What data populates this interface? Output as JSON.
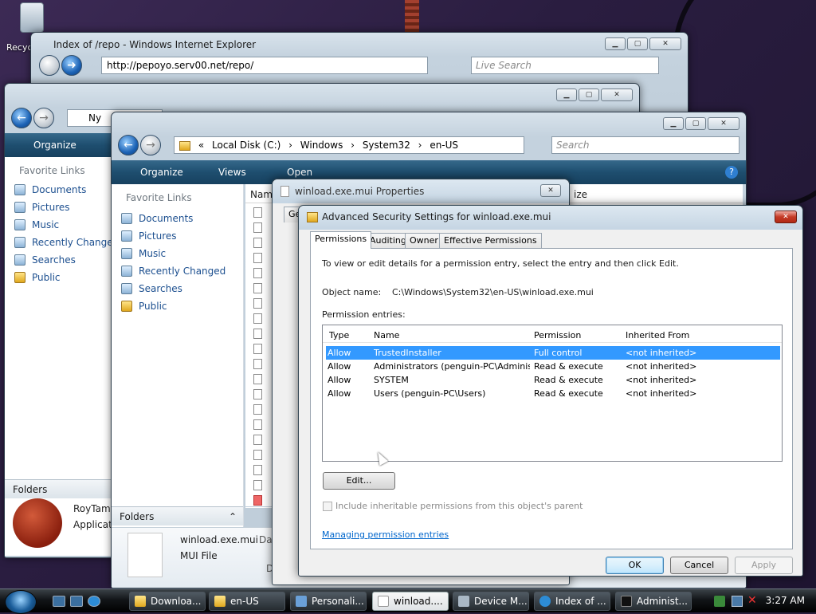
{
  "desktop": {
    "recycle_bin_label": "Recyc"
  },
  "ie": {
    "title": "Index of /repo - Windows Internet Explorer",
    "url": "http://pepoyo.serv00.net/repo/",
    "search_placeholder": "Live Search"
  },
  "explorer1": {
    "address": "Ny",
    "organize": "Organize",
    "favorite_links_header": "Favorite Links",
    "links": [
      "Documents",
      "Pictures",
      "Music",
      "Recently Changed",
      "Searches",
      "Public"
    ],
    "folders": "Folders",
    "detail_name": "RoyTam",
    "detail_type": "Applicati"
  },
  "explorer2": {
    "breadcrumb": [
      "«",
      "Local Disk (C:)",
      "Windows",
      "System32",
      "en-US"
    ],
    "search_placeholder": "Search",
    "organize": "Organize",
    "views": "Views",
    "open": "Open",
    "favorite_links_header": "Favorite Links",
    "links": [
      "Documents",
      "Pictures",
      "Music",
      "Recently Changed",
      "Searches",
      "Public"
    ],
    "folders": "Folders",
    "column_name": "Name",
    "column_size": "ize",
    "detail_filename": "winload.exe.mui",
    "detail_filetype": "MUI File",
    "detail_partial_da": "Dat",
    "detail_partial_d": "D"
  },
  "properties": {
    "title": "winload.exe.mui Properties",
    "tab_partial": "Ge"
  },
  "advanced": {
    "title": "Advanced Security Settings for winload.exe.mui",
    "tabs": [
      "Permissions",
      "Auditing",
      "Owner",
      "Effective Permissions"
    ],
    "instructions": "To view or edit details for a permission entry, select the entry and then click Edit.",
    "object_name_label": "Object name:",
    "object_name_value": "C:\\Windows\\System32\\en-US\\winload.exe.mui",
    "permission_entries_label": "Permission entries:",
    "columns": [
      "Type",
      "Name",
      "Permission",
      "Inherited From"
    ],
    "rows": [
      [
        "Allow",
        "TrustedInstaller",
        "Full control",
        "<not inherited>"
      ],
      [
        "Allow",
        "Administrators (penguin-PC\\Administra...",
        "Read & execute",
        "<not inherited>"
      ],
      [
        "Allow",
        "SYSTEM",
        "Read & execute",
        "<not inherited>"
      ],
      [
        "Allow",
        "Users (penguin-PC\\Users)",
        "Read & execute",
        "<not inherited>"
      ]
    ],
    "edit_button": "Edit...",
    "include_inheritable": "Include inheritable permissions from this object's parent",
    "managing_link": "Managing permission entries",
    "ok": "OK",
    "cancel": "Cancel",
    "apply": "Apply"
  },
  "taskbar": {
    "buttons": [
      "Downloa...",
      "en-US",
      "Personali...",
      "winload....",
      "Device M...",
      "Index of ...",
      "Administ..."
    ],
    "clock": "3:27 AM"
  }
}
